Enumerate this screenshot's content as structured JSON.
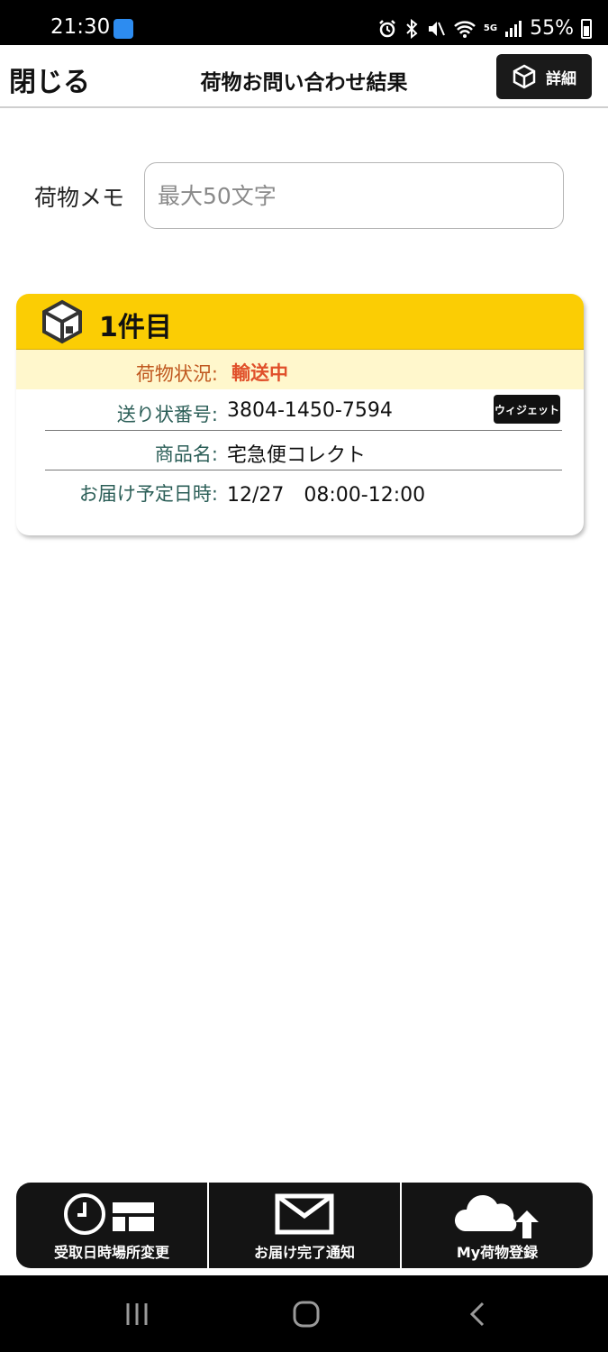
{
  "status_bar": {
    "time": "21:30",
    "battery": "55%",
    "network": "5G"
  },
  "header": {
    "close_label": "閉じる",
    "title": "荷物お問い合わせ結果",
    "detail_label": "詳細"
  },
  "memo": {
    "label": "荷物メモ",
    "placeholder": "最大50文字"
  },
  "card": {
    "title": "1件目",
    "status_label": "荷物状況:",
    "status_value": "輸送中",
    "tracking_label": "送り状番号:",
    "tracking_value": "3804-1450-7594",
    "widget_label": "ウィジェット",
    "product_label": "商品名:",
    "product_value": "宅急便コレクト",
    "delivery_label": "お届け予定日時:",
    "delivery_value": "12/27　08:00-12:00"
  },
  "actions": [
    {
      "label": "受取日時場所変更",
      "icon": "clock-calendar-icon"
    },
    {
      "label": "お届け完了通知",
      "icon": "envelope-icon"
    },
    {
      "label": "My荷物登録",
      "icon": "cloud-upload-icon"
    }
  ],
  "nav": {
    "recent": "recent-apps-icon",
    "home": "home-icon",
    "back": "back-icon"
  },
  "colors": {
    "accent_yellow": "#fbcd04",
    "status_orange": "#e0502a",
    "label_teal": "#2b5e57",
    "button_dark": "#141414"
  }
}
